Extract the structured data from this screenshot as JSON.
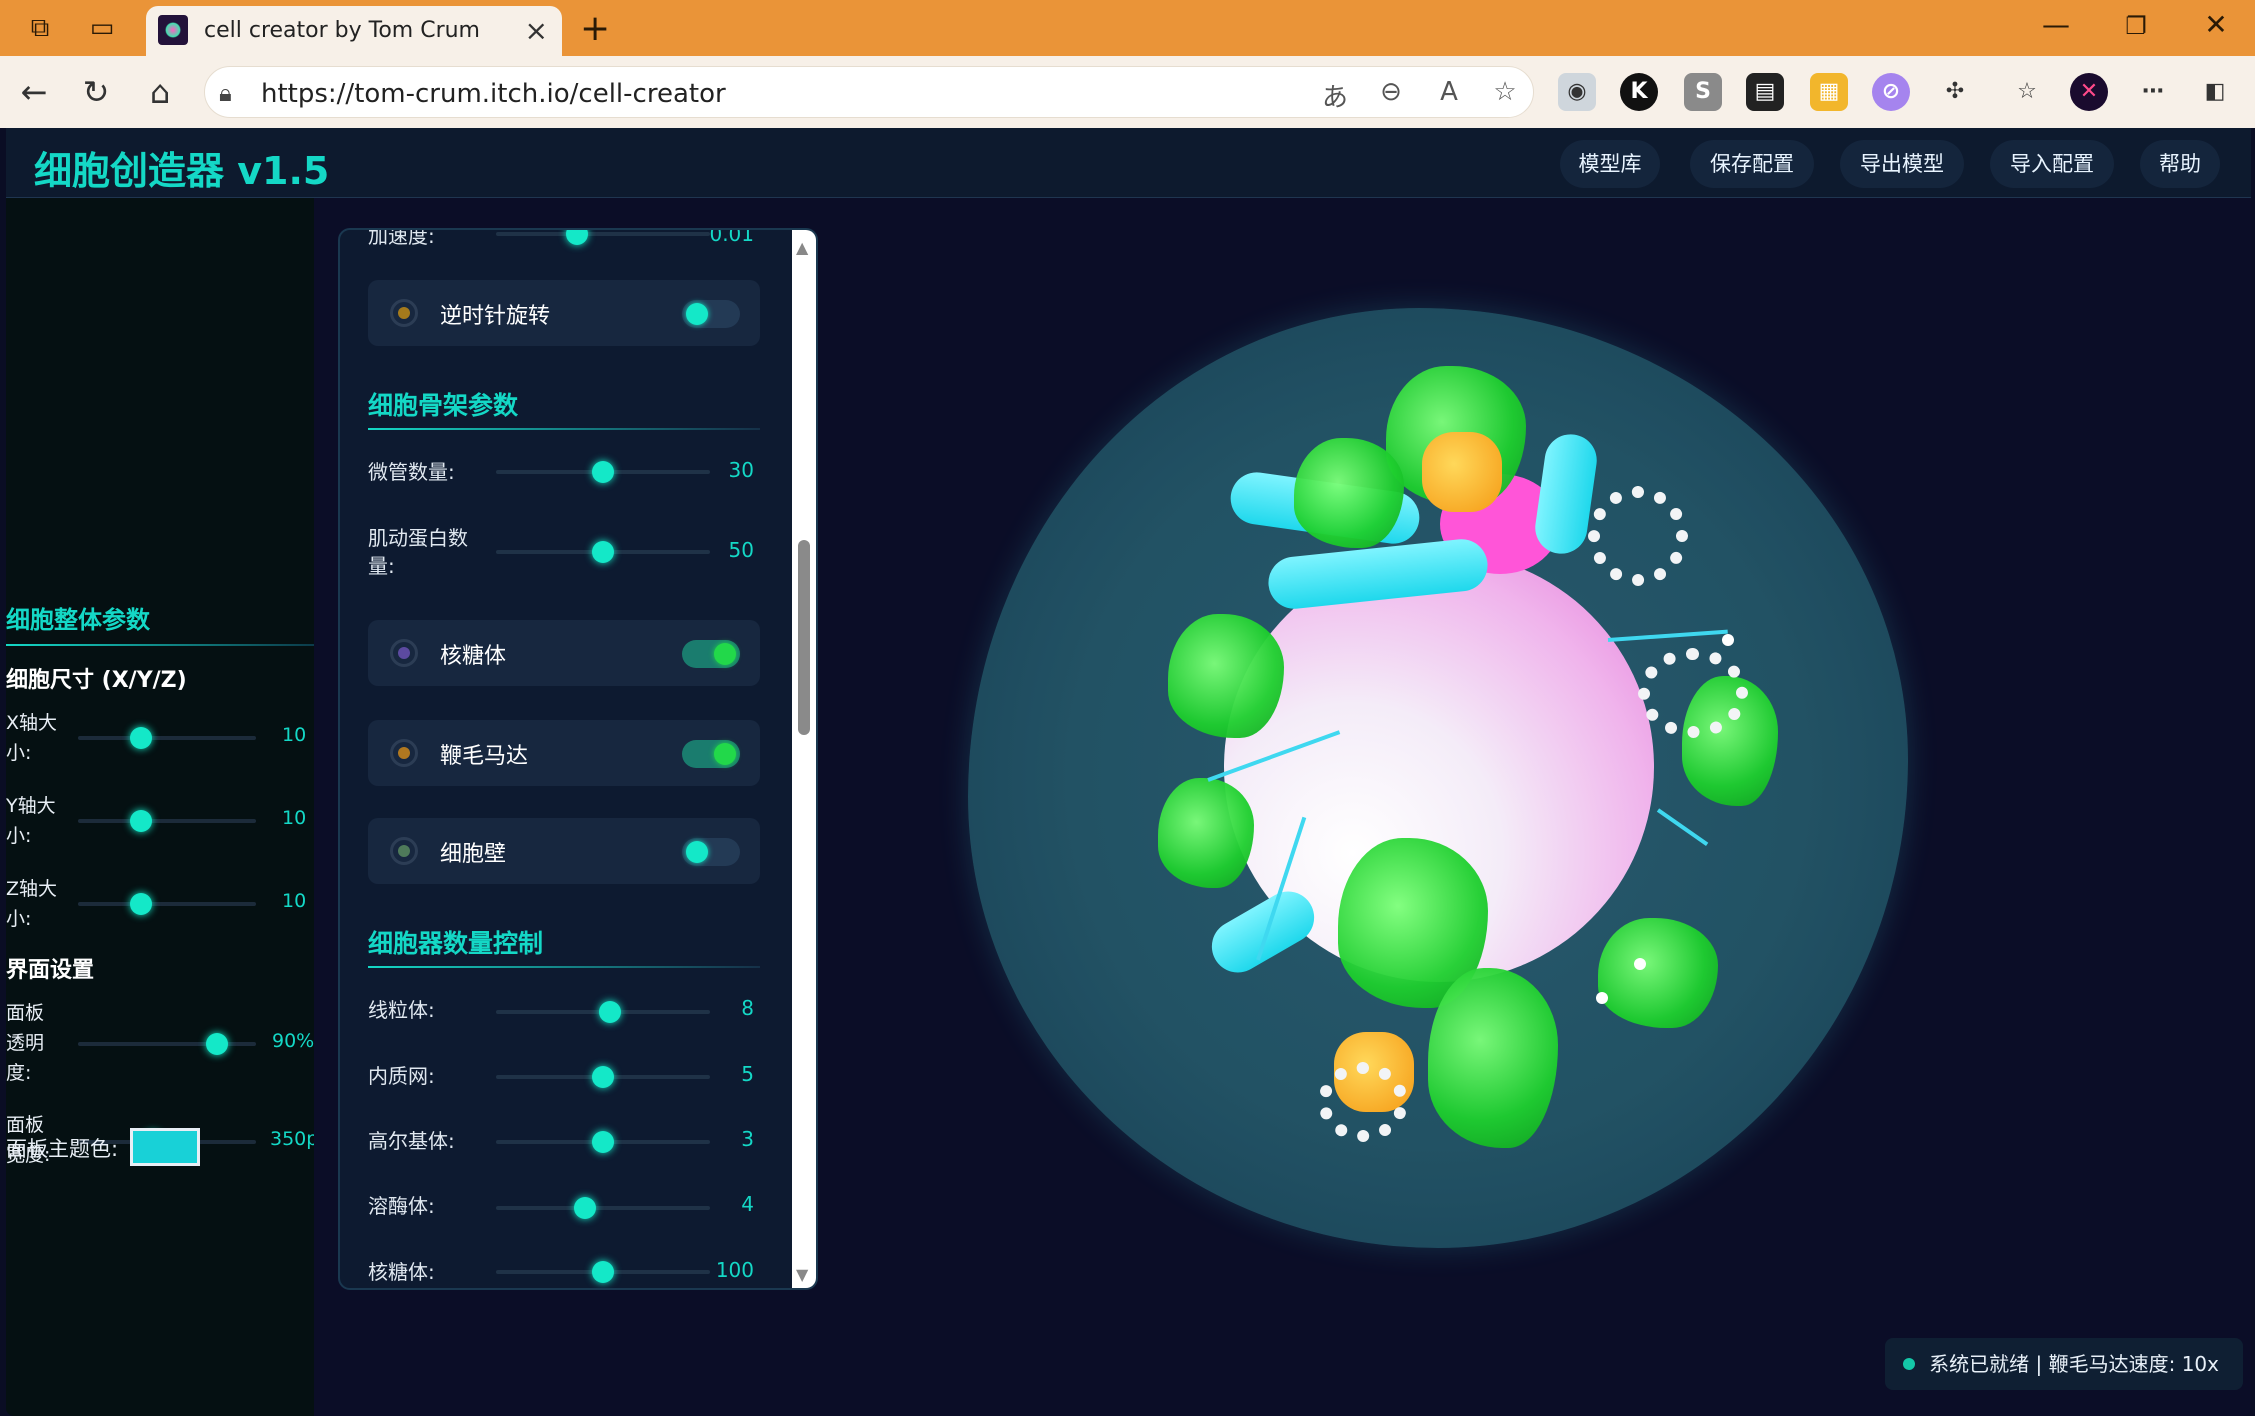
{
  "browser": {
    "tab_title": "cell creator by Tom Crum",
    "url": "https://tom-crum.itch.io/cell-creator"
  },
  "app": {
    "title": "细胞创造器 v1.5",
    "nav": [
      "模型库",
      "保存配置",
      "导出模型",
      "导入配置",
      "帮助"
    ]
  },
  "left_panel": {
    "section_title": "细胞整体参数",
    "size_title": "细胞尺寸 (X/Y/Z)",
    "sliders": [
      {
        "label": "X轴大小:",
        "value": "10",
        "fraction": 0.35
      },
      {
        "label": "Y轴大小:",
        "value": "10",
        "fraction": 0.35
      },
      {
        "label": "Z轴大小:",
        "value": "10",
        "fraction": 0.35
      }
    ],
    "ui_title": "界面设置",
    "ui_sliders": [
      {
        "label": "面板透明度:",
        "value": "90%",
        "fraction": 0.9
      },
      {
        "label": "面板宽度:",
        "value": "350px",
        "fraction": 0.42
      }
    ],
    "theme_label": "面板主题色:",
    "theme_color": "#18d1d7"
  },
  "control_panel": {
    "top_partial": {
      "label": "加速度:",
      "value": "0.01"
    },
    "toggles_top": [
      {
        "label": "逆时针旋转",
        "dot": "#a47a1c",
        "on": false
      }
    ],
    "cytoskeleton": {
      "title": "细胞骨架参数",
      "sliders": [
        {
          "label": "微管数量:",
          "value": "30",
          "fraction": 0.5
        },
        {
          "label": "肌动蛋白数量:",
          "value": "50",
          "fraction": 0.5
        }
      ]
    },
    "toggles": [
      {
        "label": "核糖体",
        "dot": "#5c4aa0",
        "on": true
      },
      {
        "label": "鞭毛马达",
        "dot": "#b07820",
        "on": true
      },
      {
        "label": "细胞壁",
        "dot": "#4e7a5a",
        "on": false
      }
    ],
    "organelles": {
      "title": "细胞器数量控制",
      "sliders": [
        {
          "label": "线粒体:",
          "value": "8",
          "fraction": 0.53
        },
        {
          "label": "内质网:",
          "value": "5",
          "fraction": 0.5
        },
        {
          "label": "高尔基体:",
          "value": "3",
          "fraction": 0.5
        },
        {
          "label": "溶酶体:",
          "value": "4",
          "fraction": 0.41
        },
        {
          "label": "核糖体:",
          "value": "100",
          "fraction": 0.5
        }
      ]
    }
  },
  "status": "系统已就绪 | 鞭毛马达速度: 10x"
}
